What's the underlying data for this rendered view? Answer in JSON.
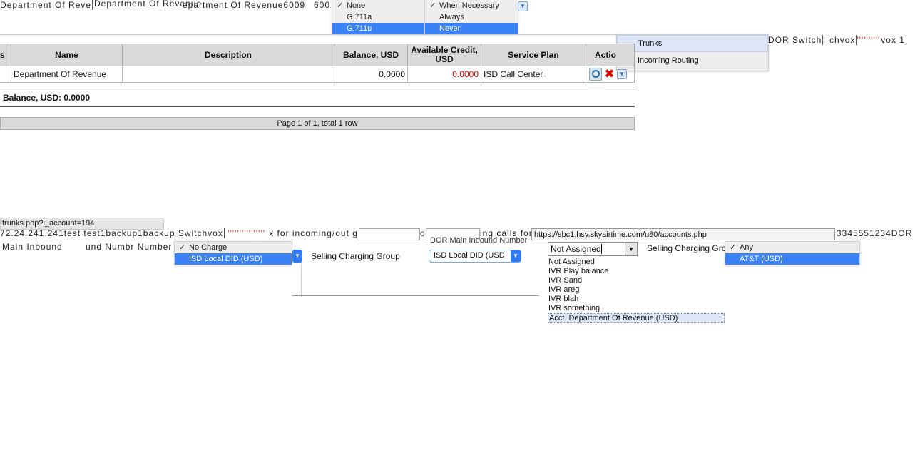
{
  "top_strip": {
    "garbled_1": "Department Of Reve",
    "garbled_2": "Department Of Revenue",
    "garbled_3": "epartment Of Revenue6009",
    "garbled_4": "600"
  },
  "codec_menu": {
    "items": [
      {
        "label": "None",
        "checked": true,
        "selected": false
      },
      {
        "label": "G.711a",
        "checked": false,
        "selected": false
      },
      {
        "label": "G.711u",
        "checked": false,
        "selected": true
      }
    ]
  },
  "when_menu": {
    "items": [
      {
        "label": "When Necessary",
        "checked": true,
        "selected": false
      },
      {
        "label": "Always",
        "checked": false,
        "selected": false
      },
      {
        "label": "Never",
        "checked": false,
        "selected": true
      }
    ]
  },
  "context_menu": {
    "items": [
      "Trunks",
      "Incoming Routing"
    ]
  },
  "right_garble": {
    "text_1": "DOR Switch",
    "text_2": "chvox",
    "text_3": "vox 1"
  },
  "accounts_table": {
    "columns": [
      "s",
      "Name",
      "Description",
      "Balance, USD",
      "Available Credit, USD",
      "Service Plan",
      "Actio"
    ],
    "rows": [
      {
        "name": "Department Of Revenue",
        "description": "",
        "balance": "0.0000",
        "available_credit": "0.0000",
        "service_plan": "ISD Call Center"
      }
    ],
    "summary": "Balance,  USD: 0.0000",
    "pagination": "Page 1 of 1, total 1 row"
  },
  "bottom": {
    "url_fragment": "trunks.php?i_account=194",
    "garbled_line": "72.24.241.241test test1backup1backup Switchvox",
    "garbled_line_b": "x for incoming/out g",
    "garbled_line_c": "o",
    "garbled_line_d": "ing calls for",
    "garbled_line_e": "3345551234DOR",
    "garbled_line2": "Main Inbound",
    "garbled_line3": "und Numbr Number",
    "charge_menu": {
      "items": [
        {
          "label": "No Charge",
          "checked": true,
          "selected": false
        },
        {
          "label": "ISD Local DID (USD)",
          "checked": false,
          "selected": true
        }
      ]
    },
    "selling_charging_group_label": "Selling Charging Group",
    "dor_inbound_label": "DOR Main Inbound Number",
    "local_did_select": "ISD Local DID (USD",
    "url_field": "https://sbc1.hsv.skyairtime.com/u80/accounts.php",
    "not_assigned_select": "Not Assigned",
    "selling_charging_group_label2": "Selling Charging Gro",
    "any_menu": {
      "items": [
        {
          "label": "Any",
          "checked": true,
          "selected": false
        },
        {
          "label": "AT&T (USD)",
          "checked": false,
          "selected": true
        }
      ]
    },
    "ivr_list": [
      "Not Assigned",
      "IVR Play balance",
      "IVR Sand",
      "IVR areg",
      "IVR blah",
      "IVR something",
      "Acct. Department Of Revenue (USD)"
    ]
  }
}
